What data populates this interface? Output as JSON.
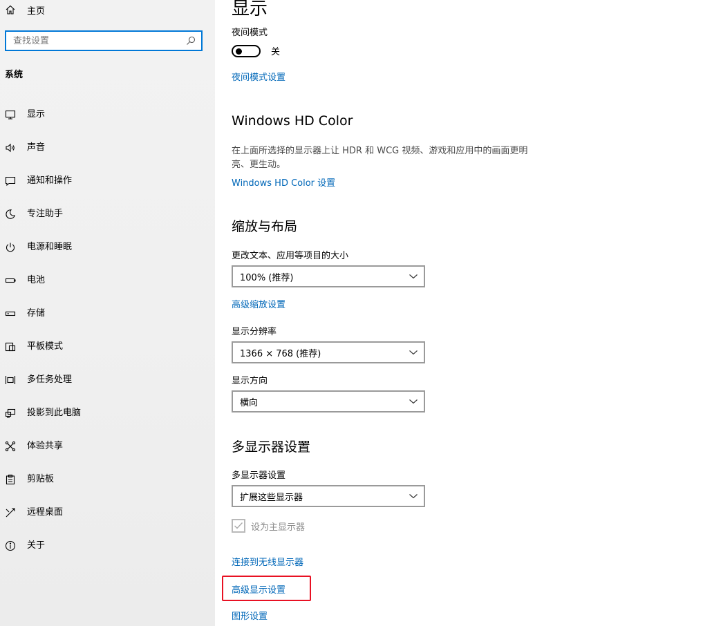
{
  "sidebar": {
    "home_label": "主页",
    "search_placeholder": "查找设置",
    "section_title": "系统",
    "items": [
      {
        "label": "显示",
        "icon": "monitor-icon"
      },
      {
        "label": "声音",
        "icon": "speaker-icon"
      },
      {
        "label": "通知和操作",
        "icon": "notification-icon"
      },
      {
        "label": "专注助手",
        "icon": "moon-icon"
      },
      {
        "label": "电源和睡眠",
        "icon": "power-icon"
      },
      {
        "label": "电池",
        "icon": "battery-icon"
      },
      {
        "label": "存储",
        "icon": "storage-icon"
      },
      {
        "label": "平板模式",
        "icon": "tablet-icon"
      },
      {
        "label": "多任务处理",
        "icon": "multitask-icon"
      },
      {
        "label": "投影到此电脑",
        "icon": "project-icon"
      },
      {
        "label": "体验共享",
        "icon": "share-icon"
      },
      {
        "label": "剪贴板",
        "icon": "clipboard-icon"
      },
      {
        "label": "远程桌面",
        "icon": "remote-desktop-icon"
      },
      {
        "label": "关于",
        "icon": "info-icon"
      }
    ]
  },
  "main": {
    "title": "显示",
    "night_light": {
      "label": "夜间模式",
      "state": "关",
      "settings_link": "夜间模式设置"
    },
    "hd_color": {
      "heading": "Windows HD Color",
      "description": "在上面所选择的显示器上让 HDR 和 WCG 视频、游戏和应用中的画面更明亮、更生动。",
      "link": "Windows HD Color 设置"
    },
    "scale_layout": {
      "heading": "缩放与布局",
      "size_label": "更改文本、应用等项目的大小",
      "size_value": "100% (推荐)",
      "advanced_scaling_link": "高级缩放设置",
      "resolution_label": "显示分辨率",
      "resolution_value": "1366 × 768 (推荐)",
      "orientation_label": "显示方向",
      "orientation_value": "横向"
    },
    "multi_display": {
      "heading": "多显示器设置",
      "label": "多显示器设置",
      "value": "扩展这些显示器",
      "primary_checkbox_label": "设为主显示器",
      "wireless_link": "连接到无线显示器",
      "advanced_display_link": "高级显示设置",
      "graphics_link": "图形设置"
    }
  },
  "colors": {
    "accent": "#0078d7",
    "link": "#0067b8",
    "highlight": "#e81123"
  }
}
